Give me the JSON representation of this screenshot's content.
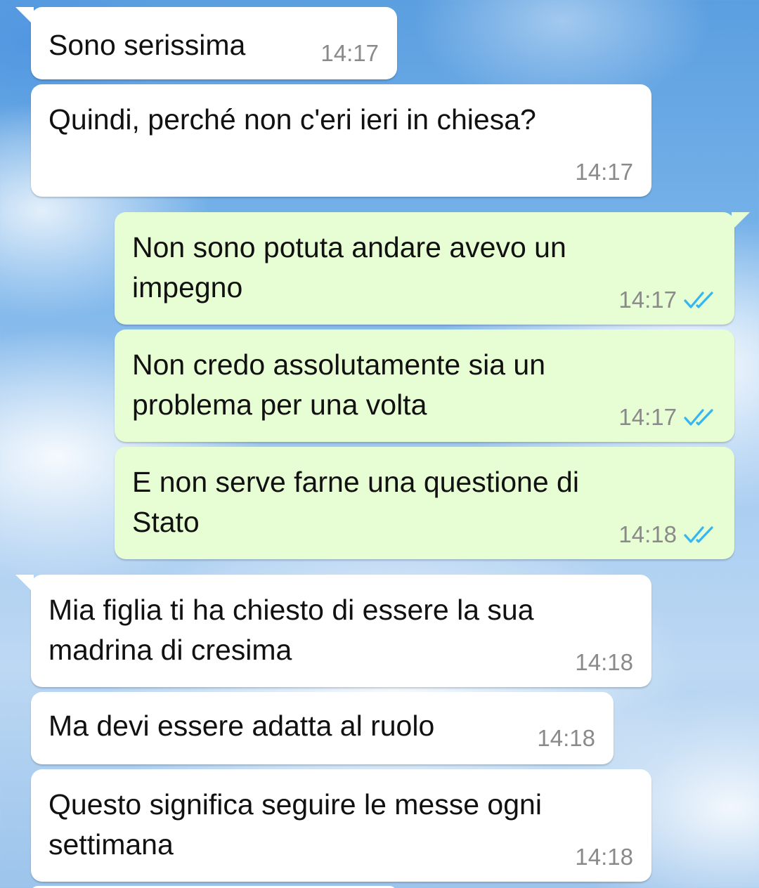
{
  "colors": {
    "incoming_bubble": "#ffffff",
    "outgoing_bubble": "#e7fdd3",
    "timestamp": "#8a8a8a",
    "read_ticks": "#34b7f1"
  },
  "messages": [
    {
      "direction": "incoming",
      "text": "Sono serissima",
      "time": "14:17"
    },
    {
      "direction": "incoming",
      "text": "Quindi, perché non c'eri ieri in chiesa?",
      "time": "14:17"
    },
    {
      "direction": "outgoing",
      "text": "Non sono potuta andare avevo un\nimpegno",
      "time": "14:17",
      "status_icon": "double-check-read-icon"
    },
    {
      "direction": "outgoing",
      "text": "Non credo assolutamente sia un\nproblema per una volta",
      "time": "14:17",
      "status_icon": "double-check-read-icon"
    },
    {
      "direction": "outgoing",
      "text": "E non serve farne una questione di\nStato",
      "time": "14:18",
      "status_icon": "double-check-read-icon"
    },
    {
      "direction": "incoming",
      "text": "Mia figlia ti ha chiesto di essere la sua\nmadrina di cresima",
      "time": "14:18"
    },
    {
      "direction": "incoming",
      "text": "Ma devi essere adatta al ruolo",
      "time": "14:18"
    },
    {
      "direction": "incoming",
      "text": "Questo significa seguire le messe ogni\nsettimana",
      "time": "14:18"
    }
  ]
}
